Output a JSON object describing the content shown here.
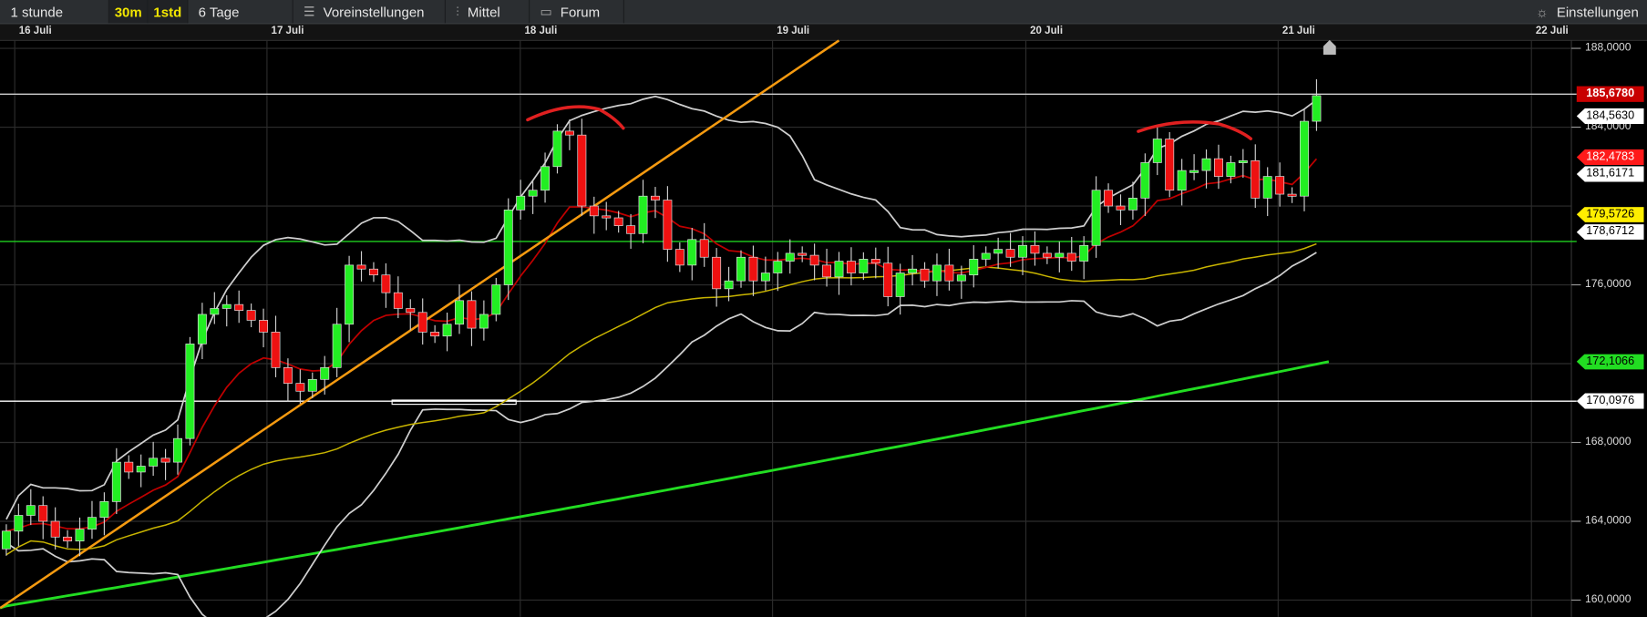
{
  "toolbar": {
    "period": "1 stunde",
    "interval_30m": "30m",
    "interval_1std": "1std",
    "range": "6 Tage",
    "presets": "Voreinstellungen",
    "indicators": "Mittel",
    "forum": "Forum",
    "settings": "Einstellungen"
  },
  "chart_data": {
    "type": "candlestick",
    "title": "",
    "x_tick_labels": [
      "16 Juli",
      "17 Juli",
      "18 Juli",
      "19 Juli",
      "20 Juli",
      "21 Juli",
      "22 Juli"
    ],
    "y_tick_labels": [
      "188,0000",
      "184,0000",
      "176,0000",
      "168,0000",
      "164,0000",
      "160,0000"
    ],
    "ylim": [
      159.2,
      188.4
    ],
    "grid": true,
    "close": [
      163.5,
      164.3,
      164.8,
      164.0,
      163.2,
      163.0,
      163.6,
      164.2,
      165.0,
      167.0,
      166.5,
      166.8,
      167.2,
      167.0,
      168.2,
      173.0,
      174.5,
      174.8,
      175.0,
      174.7,
      174.2,
      173.6,
      171.8,
      171.0,
      170.6,
      171.2,
      171.8,
      174.0,
      177.0,
      176.8,
      176.5,
      175.6,
      174.8,
      174.6,
      173.6,
      173.4,
      174.0,
      175.2,
      173.8,
      174.5,
      176.0,
      179.8,
      180.5,
      180.8,
      182.0,
      183.8,
      183.6,
      180.0,
      179.5,
      179.4,
      179.0,
      178.6,
      180.5,
      180.3,
      177.8,
      177.0,
      178.3,
      177.4,
      175.8,
      176.2,
      177.4,
      176.2,
      176.6,
      177.2,
      177.6,
      177.5,
      177.0,
      176.4,
      177.2,
      176.6,
      177.3,
      177.1,
      175.4,
      176.6,
      176.8,
      176.2,
      177.0,
      176.2,
      176.5,
      177.3,
      177.6,
      177.8,
      177.4,
      178.0,
      177.6,
      177.4,
      177.6,
      177.2,
      178.0,
      180.8,
      180.0,
      179.8,
      180.4,
      182.2,
      183.4,
      180.8,
      181.8,
      181.8,
      182.4,
      181.5,
      182.2,
      182.3,
      180.4,
      181.5,
      180.6,
      180.5,
      184.3,
      185.6
    ],
    "first_open": 162.6,
    "ma_long": {
      "start": 159.6,
      "end": 172.1
    },
    "trendline": {
      "from": [
        -0.5,
        159.6
      ],
      "to": [
        68,
        188.4
      ]
    },
    "horizontal_lines": [
      {
        "price": 185.678,
        "color": "#cfcfcf"
      },
      {
        "price": 178.2,
        "color": "#1fd01f"
      },
      {
        "price": 170.0976,
        "color": "#ffffff"
      }
    ],
    "price_labels": [
      {
        "text": "185,6780",
        "price": 185.678,
        "bg": "#c80000",
        "fg": "#ffffff"
      },
      {
        "text": "184,5630",
        "price": 184.563,
        "bg": "#ffffff",
        "fg": "#000000"
      },
      {
        "text": "182,4783",
        "price": 182.4783,
        "bg": "#ff1a1a",
        "fg": "#ffffff"
      },
      {
        "text": "181,6171",
        "price": 181.6171,
        "bg": "#ffffff",
        "fg": "#000000"
      },
      {
        "text": "179,5726",
        "price": 179.5726,
        "bg": "#ffee00",
        "fg": "#000000"
      },
      {
        "text": "178,6712",
        "price": 178.6712,
        "bg": "#ffffff",
        "fg": "#000000"
      },
      {
        "text": "172,1066",
        "price": 172.1066,
        "bg": "#22dd22",
        "fg": "#000000"
      },
      {
        "text": "170,0976",
        "price": 170.0976,
        "bg": "#ffffff",
        "fg": "#000000"
      }
    ],
    "colors": {
      "up": "#22ee22",
      "down": "#ee1111",
      "ema": "#c00000",
      "sma": "#c8b400",
      "bands": "#cfcfcf",
      "ma_long": "#22dd22",
      "trend": "#f59a10",
      "annotation": "#e02020"
    }
  }
}
